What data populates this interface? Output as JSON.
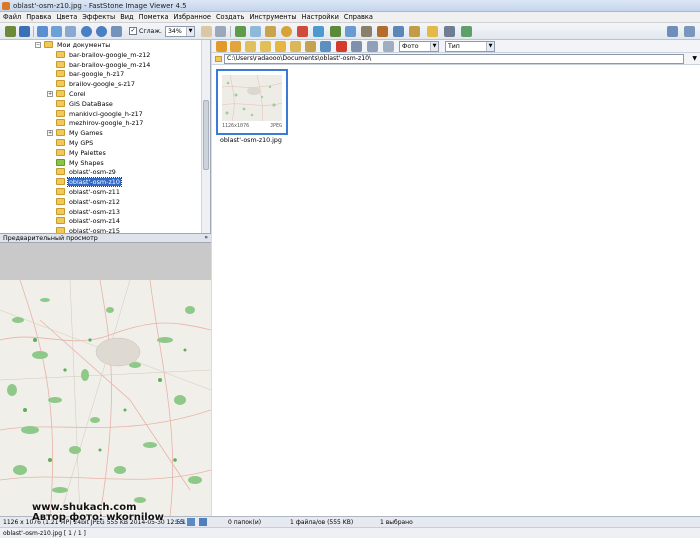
{
  "window": {
    "title": "oblast'-osm-z10.jpg  -  FastStone Image Viewer 4.5"
  },
  "menu": [
    "Файл",
    "Правка",
    "Цвета",
    "Эффекты",
    "Вид",
    "Пометка",
    "Избранное",
    "Создать",
    "Инструменты",
    "Настройки",
    "Справка"
  ],
  "toolbar": {
    "smooth_label": "Сглаж.",
    "smooth_checked": "✓",
    "zoom": "34%"
  },
  "tree": {
    "items": [
      {
        "label": "Мои документы",
        "level": 0,
        "exp": "−"
      },
      {
        "label": "bar-brailov-google_m-z12",
        "level": 1
      },
      {
        "label": "bar-brailov-google_m-z14",
        "level": 1
      },
      {
        "label": "bar-google_h-z17",
        "level": 1
      },
      {
        "label": "brailov-google_s-z17",
        "level": 1
      },
      {
        "label": "Corel",
        "level": 1,
        "exp": "+"
      },
      {
        "label": "GIS DataBase",
        "level": 1
      },
      {
        "label": "mankivci-google_h-z17",
        "level": 1
      },
      {
        "label": "mezhirov-google_h-z17",
        "level": 1
      },
      {
        "label": "My Games",
        "level": 1,
        "exp": "+"
      },
      {
        "label": "My GPS",
        "level": 1
      },
      {
        "label": "My Palettes",
        "level": 1
      },
      {
        "label": "My Shapes",
        "level": 1,
        "green": true
      },
      {
        "label": "oblast'-osm-z9",
        "level": 1
      },
      {
        "label": "oblast'-osm-z10",
        "level": 1,
        "selected": true
      },
      {
        "label": "oblast'-osm-z11",
        "level": 1
      },
      {
        "label": "oblast'-osm-z12",
        "level": 1
      },
      {
        "label": "oblast'-osm-z13",
        "level": 1
      },
      {
        "label": "oblast'-osm-z14",
        "level": 1
      },
      {
        "label": "oblast'-osm-z15",
        "level": 1
      }
    ]
  },
  "preview": {
    "header": "Предварительный просмотр"
  },
  "browser": {
    "filter": "Фото",
    "sort": "Тип",
    "path": "C:\\Users\\radaooo\\Documents\\oblast'-osm-z10\\",
    "thumb": {
      "dims": "1126x1076",
      "type": "JPEG",
      "caption": "oblast'-osm-z10.jpg"
    }
  },
  "status": {
    "info": "1126 x 1076 (1.21 MP)  24bit  JPEG  555 KB  2014-05-30 12:55",
    "ratio": "1:1",
    "folders": "0 папок(и)",
    "files": "1 файла/ов (555 KB)",
    "selected": "1 выбрано",
    "file": "oblast'-osm-z10.jpg [ 1 / 1 ]"
  },
  "watermark": {
    "site": "www.shukach.com",
    "author": "Автор фото: wkornilow"
  },
  "colors": {
    "selection": "#3169c6",
    "thumb_border": "#3a7bd5",
    "forest": "#5fae5a"
  }
}
